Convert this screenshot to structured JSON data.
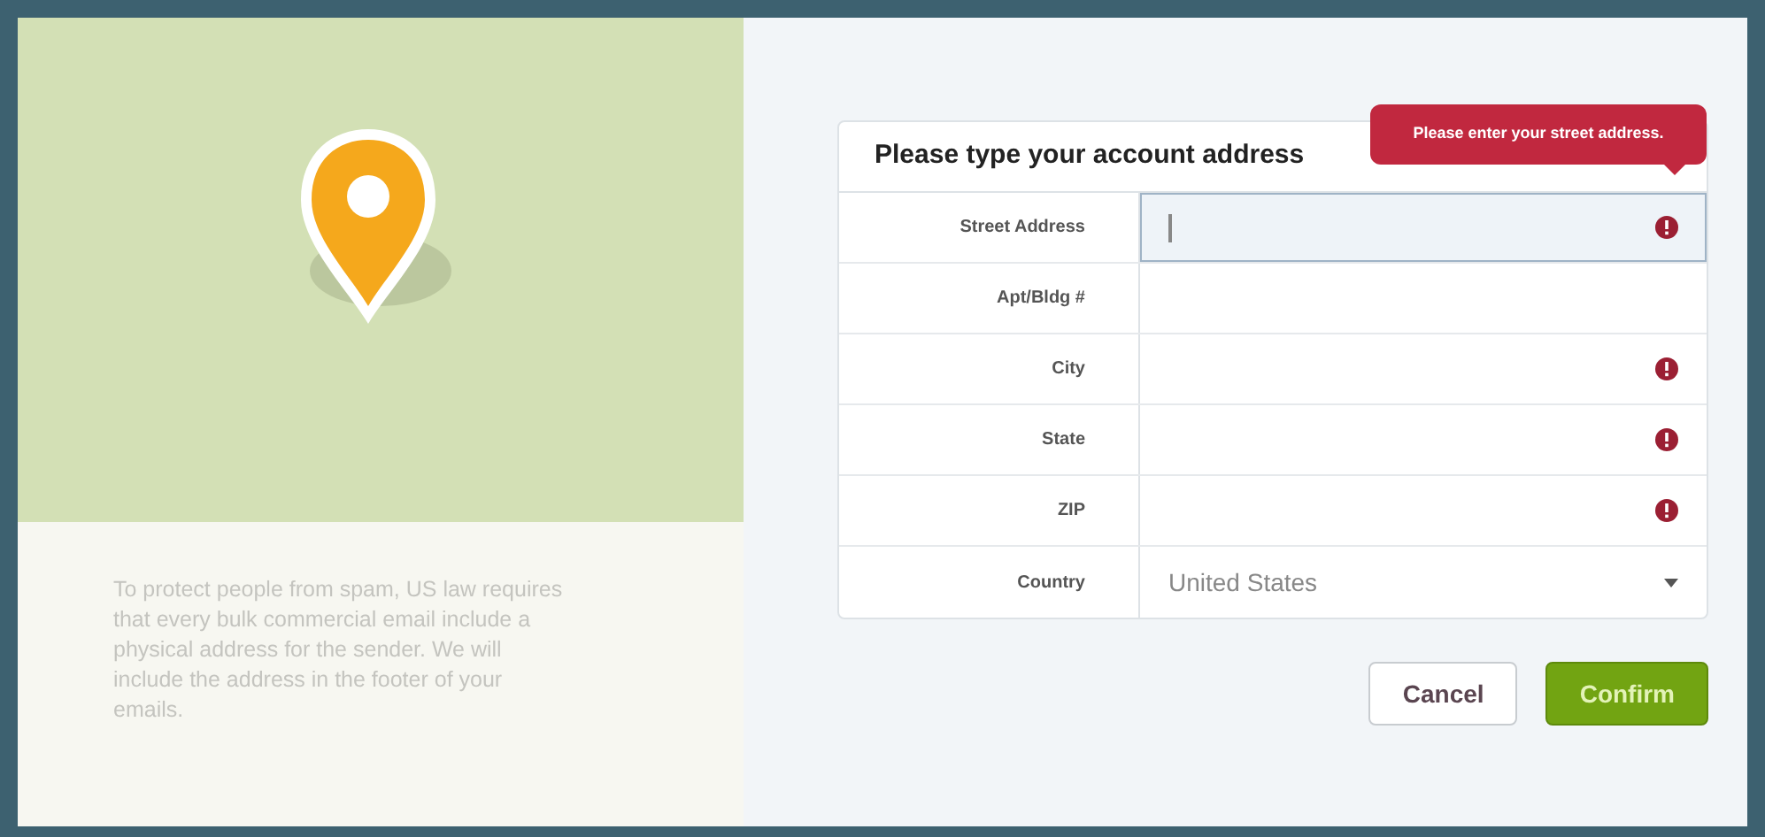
{
  "info_text": "To protect people from spam, US law requires that every bulk commercial email include a physical address for the sender. We will include the address in the footer of your emails.",
  "form": {
    "title": "Please type your account address",
    "error_tooltip": "Please enter your street address.",
    "fields": [
      {
        "label": "Street Address",
        "kind": "text",
        "error": true,
        "focused": true
      },
      {
        "label": "Apt/Bldg #",
        "kind": "text",
        "error": false,
        "focused": false
      },
      {
        "label": "City",
        "kind": "text",
        "error": true,
        "focused": false
      },
      {
        "label": "State",
        "kind": "text",
        "error": true,
        "focused": false
      },
      {
        "label": "ZIP",
        "kind": "text",
        "error": true,
        "focused": false
      },
      {
        "label": "Country",
        "kind": "select",
        "value": "United States"
      }
    ]
  },
  "buttons": [
    {
      "label": "Cancel",
      "kind": "secondary"
    },
    {
      "label": "Confirm",
      "kind": "primary"
    }
  ]
}
